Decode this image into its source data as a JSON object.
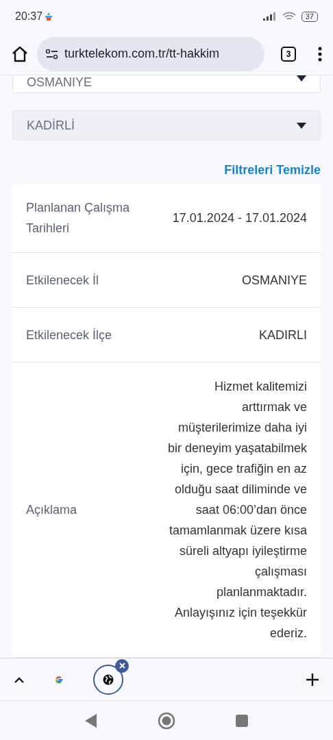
{
  "status_bar": {
    "time": "20:37",
    "battery": "37"
  },
  "browser": {
    "url": "turktelekom.com.tr/tt-hakkim",
    "tab_count": "3"
  },
  "filters": [
    {
      "value": "OSMANIYE",
      "disabled": false
    },
    {
      "value": "KADİRLİ",
      "disabled": true
    }
  ],
  "clear_filters": "Filtreleri Temizle",
  "details": [
    {
      "label": "Planlanan Çalışma Tarihleri",
      "value": "17.01.2024 - 17.01.2024"
    },
    {
      "label": "Etkilenecek İl",
      "value": "OSMANIYE"
    },
    {
      "label": "Etkilenecek İlçe",
      "value": "KADIRLI"
    },
    {
      "label": "Açıklama",
      "value": "Hizmet kalitemizi arttırmak ve müşterilerimize daha iyi bir deneyim yaşatabilmek için, gece trafiğin en az olduğu saat diliminde ve saat 06:00’dan önce tamamlanmak üzere kısa süreli altyapı iyileştirme çalışması planlanmaktadır. Anlayışınız için teşekkür ederiz."
    }
  ],
  "tab_strip": [
    {
      "kind": "google",
      "selected": false
    },
    {
      "kind": "globe",
      "selected": true
    }
  ]
}
